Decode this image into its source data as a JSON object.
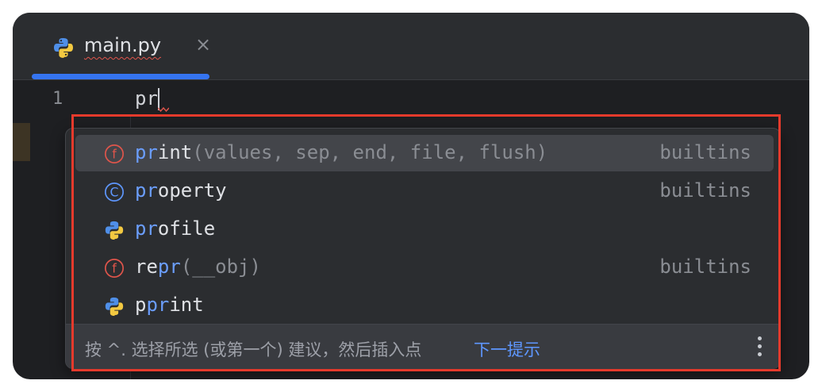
{
  "tab": {
    "title": "main.py",
    "close_glyph": "×",
    "icon": "python-file-icon"
  },
  "editor": {
    "line_number": "1",
    "code": "pr"
  },
  "completion": {
    "items": [
      {
        "icon": "function-icon",
        "match": "pr",
        "rest": "int",
        "params": "(values, sep, end, file, flush)",
        "source": "builtins",
        "selected": true
      },
      {
        "icon": "class-icon",
        "match": "pr",
        "rest": "operty",
        "params": "",
        "source": "builtins",
        "selected": false
      },
      {
        "icon": "python-module-icon",
        "match": "pr",
        "rest": "ofile",
        "params": "",
        "source": "",
        "selected": false
      },
      {
        "icon": "function-icon",
        "pre": "re",
        "match": "pr",
        "rest": "",
        "params": "(__obj)",
        "source": "builtins",
        "selected": false
      },
      {
        "icon": "python-module-icon",
        "pre": "p",
        "match": "pr",
        "rest": "int",
        "params": "",
        "source": "",
        "selected": false
      }
    ],
    "footer_hint": "按 ^. 选择所选 (或第一个) 建议，然后插入点",
    "footer_link": "下一提示",
    "more_icon": "more-vertical-icon"
  },
  "colors": {
    "accent": "#3574f0",
    "match": "#6b9eff",
    "highlight": "#e53a2c",
    "function_icon": "#e0554b",
    "class_icon": "#5e97ff"
  }
}
